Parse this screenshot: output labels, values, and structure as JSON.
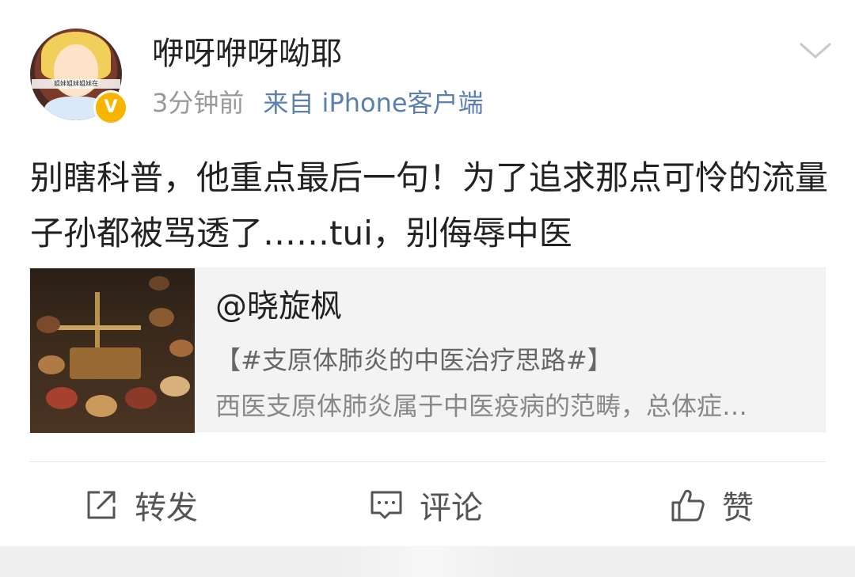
{
  "post": {
    "author": {
      "name": "咿呀咿呀呦耶",
      "avatar_banner": "姐妹姐妹姐妹在",
      "verified_badge": "V"
    },
    "time": "3分钟前",
    "source": "来自 iPhone客户端",
    "text": "别瞎科普，他重点最后一句！为了追求那点可怜的流量子孙都被骂透了……tui，别侮辱中医",
    "repost_card": {
      "author": "@晓旋枫",
      "tag_line": "【#支原体肺炎的中医治疗思路#】",
      "excerpt": "西医支原体肺炎属于中医疫病的范畴，总体症…"
    },
    "actions": {
      "repost": "转发",
      "comment": "评论",
      "like": "赞"
    }
  },
  "colors": {
    "source_link": "#5a7fb0",
    "badge": "#f7b500",
    "card_bg": "#f3f3f3"
  },
  "icons": [
    "chevron-down-icon",
    "repost-icon",
    "comment-icon",
    "like-icon",
    "verified-icon"
  ]
}
